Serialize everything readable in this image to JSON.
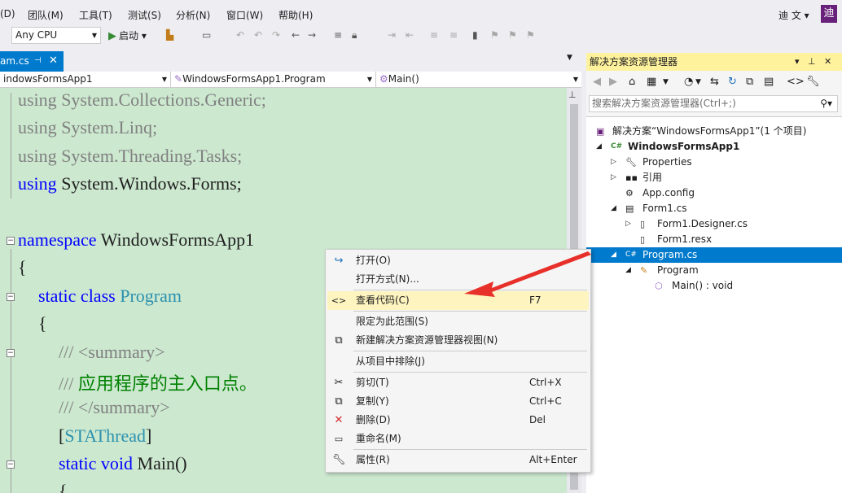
{
  "menubar": {
    "items": [
      "(D)",
      "团队(M)",
      "工具(T)",
      "测试(S)",
      "分析(N)",
      "窗口(W)",
      "帮助(H)"
    ],
    "user_name": "迪 文",
    "user_dropdown": "▾",
    "avatar_text": "迪"
  },
  "toolbar": {
    "platform": "Any CPU",
    "start_label": "启动",
    "start_dropdown": "▾"
  },
  "editor": {
    "tab_label": "am.cs",
    "tab_pin": "⊣",
    "tab_close": "✕",
    "nav_project": "indowsFormsApp1",
    "nav_class": "WindowsFormsApp1.Program",
    "nav_member": "Main()",
    "code": {
      "l1_kw": "using",
      "l1_ns": " System.Collections.Generic;",
      "l2_kw": "using",
      "l2_ns": " System.Linq;",
      "l3_kw": "using",
      "l3_ns": " System.Threading.Tasks;",
      "l4_kw": "using",
      "l4_ns": " System.Windows.Forms;",
      "l5_kw": "namespace",
      "l5_name": " WindowsFormsApp1",
      "l6": "{",
      "l7_kw": "static class",
      "l7_type": " Program",
      "l8": "{",
      "l9_gr": "/// <summary>",
      "l10_gr": "/// ",
      "l10_cm": "应用程序的主入口点。",
      "l11_gr": "/// </summary>",
      "l12_open": "[",
      "l12_attr": "STAThread",
      "l12_close": "]",
      "l13_kw": "static void",
      "l13_name": " Main()",
      "l14": "{"
    }
  },
  "solution_explorer": {
    "title": "解决方案资源管理器",
    "search_placeholder": "搜索解决方案资源管理器(Ctrl+;)",
    "nodes": [
      {
        "label": "解决方案“WindowsFormsApp1”(1 个项目)"
      },
      {
        "label": "WindowsFormsApp1"
      },
      {
        "label": "Properties"
      },
      {
        "label": "引用"
      },
      {
        "label": "App.config"
      },
      {
        "label": "Form1.cs"
      },
      {
        "label": "Form1.Designer.cs"
      },
      {
        "label": "Form1.resx"
      },
      {
        "label": "Program.cs"
      },
      {
        "label": "Program"
      },
      {
        "label": "Main() : void"
      }
    ]
  },
  "context_menu": {
    "items": [
      {
        "label": "打开(O)",
        "shortcut": ""
      },
      {
        "label": "打开方式(N)...",
        "shortcut": ""
      },
      {
        "label": "查看代码(C)",
        "shortcut": "F7"
      },
      {
        "label": "限定为此范围(S)",
        "shortcut": ""
      },
      {
        "label": "新建解决方案资源管理器视图(N)",
        "shortcut": ""
      },
      {
        "label": "从项目中排除(J)",
        "shortcut": ""
      },
      {
        "label": "剪切(T)",
        "shortcut": "Ctrl+X"
      },
      {
        "label": "复制(Y)",
        "shortcut": "Ctrl+C"
      },
      {
        "label": "删除(D)",
        "shortcut": "Del"
      },
      {
        "label": "重命名(M)",
        "shortcut": ""
      },
      {
        "label": "属性(R)",
        "shortcut": "Alt+Enter"
      }
    ]
  },
  "colors": {
    "accent": "#007acc",
    "editor_background": "#cce8cf",
    "highlight": "#fdf4bf",
    "panel_title_active": "#fff29d",
    "annotation_arrow": "#e8302a",
    "keyword": "#0000ff",
    "type": "#2b91af",
    "comment": "#008000"
  }
}
